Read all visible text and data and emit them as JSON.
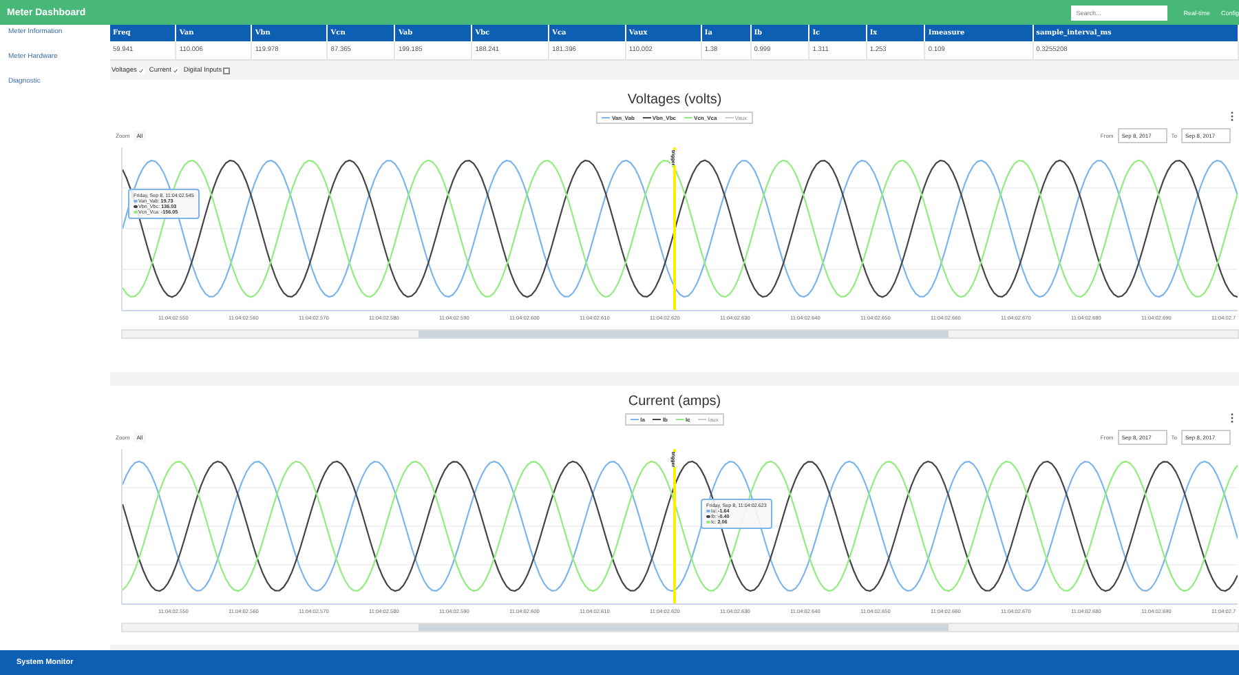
{
  "header": {
    "title": "Meter Dashboard",
    "search_placeholder": "Search...",
    "links": [
      "Real-time",
      "Config"
    ]
  },
  "sidebar": {
    "items": [
      {
        "label": "Meter Information",
        "selected": false
      },
      {
        "label": "Meter Hardware",
        "selected": false
      },
      {
        "label": "Diagnostic",
        "selected": false
      }
    ]
  },
  "table": {
    "columns": [
      "Freq",
      "Van",
      "Vbn",
      "Vcn",
      "Vab",
      "Vbc",
      "Vca",
      "Vaux",
      "Ia",
      "Ib",
      "Ic",
      "Ix",
      "Imeasure",
      "sample_interval_ms"
    ],
    "rows": [
      [
        "59.941",
        "110.006",
        "119.978",
        "87.365",
        "199.185",
        "188.241",
        "181.396",
        "110.002",
        "1.38",
        "0.999",
        "1.311",
        "1.253",
        "0.109",
        "0.3255208"
      ]
    ]
  },
  "toggles": [
    {
      "label": "Voltages",
      "checked": true
    },
    {
      "label": "Current",
      "checked": true
    },
    {
      "label": "Digital Inputs",
      "checked": false
    }
  ],
  "charts": [
    {
      "title": "Voltages (volts)",
      "legend": [
        {
          "label": "Van_Vab",
          "color": "#7cb5ec",
          "visible": true
        },
        {
          "label": "Vbn_Vbc",
          "color": "#434348",
          "visible": true
        },
        {
          "label": "Vcn_Vca",
          "color": "#90ed7d",
          "visible": true
        },
        {
          "label": "Vaux",
          "color": "#cccccc",
          "visible": false
        }
      ],
      "zoom_label": "Zoom",
      "zoom_button": "All",
      "from_label": "From",
      "from_value": "Sep 8, 2017",
      "to_label": "To",
      "to_value": "Sep 8, 2017",
      "flag_label": "trigger",
      "tooltip": {
        "time": "Friday, Sep 8, 11:04:02.545",
        "rows": [
          {
            "label": "Van_Vab:",
            "value": "19.73",
            "color": "#7cb5ec"
          },
          {
            "label": "Vbn_Vbc:",
            "value": "136.03",
            "color": "#434348"
          },
          {
            "label": "Vcn_Vca:",
            "value": "-156.05",
            "color": "#90ed7d"
          }
        ]
      },
      "x_labels": [
        "11:04:02.550",
        "11:04:02.560",
        "11:04:02.570",
        "11:04:02.580",
        "11:04:02.590",
        "11:04:02.600",
        "11:04:02.610",
        "11:04:02.620",
        "11:04:02.630",
        "11:04:02.640",
        "11:04:02.650",
        "11:04:02.660",
        "11:04:02.670",
        "11:04:02.680",
        "11:04:02.690",
        "11:04:02.7"
      ]
    },
    {
      "title": "Current (amps)",
      "legend": [
        {
          "label": "Ia",
          "color": "#7cb5ec",
          "visible": true
        },
        {
          "label": "Ib",
          "color": "#434348",
          "visible": true
        },
        {
          "label": "Ic",
          "color": "#90ed7d",
          "visible": true
        },
        {
          "label": "Iaux",
          "color": "#cccccc",
          "visible": false
        }
      ],
      "zoom_label": "Zoom",
      "zoom_button": "All",
      "from_label": "From",
      "from_value": "Sep 8, 2017",
      "to_label": "To",
      "to_value": "Sep 8, 2017",
      "flag_label": "trigger",
      "tooltip": {
        "time": "Friday, Sep 8, 11:04:02.623",
        "rows": [
          {
            "label": "Ia:",
            "value": "-1.64",
            "color": "#7cb5ec"
          },
          {
            "label": "Ib:",
            "value": "-0.40",
            "color": "#434348"
          },
          {
            "label": "Ic:",
            "value": "2.06",
            "color": "#90ed7d"
          }
        ]
      },
      "x_labels": [
        "11:04:02.550",
        "11:04:02.560",
        "11:04:02.570",
        "11:04:02.580",
        "11:04:02.590",
        "11:04:02.600",
        "11:04:02.610",
        "11:04:02.620",
        "11:04:02.630",
        "11:04:02.640",
        "11:04:02.650",
        "11:04:02.660",
        "11:04:02.670",
        "11:04:02.680",
        "11:04:02.690",
        "11:04:02.7"
      ]
    }
  ],
  "footer": {
    "title": "System Monitor"
  }
}
